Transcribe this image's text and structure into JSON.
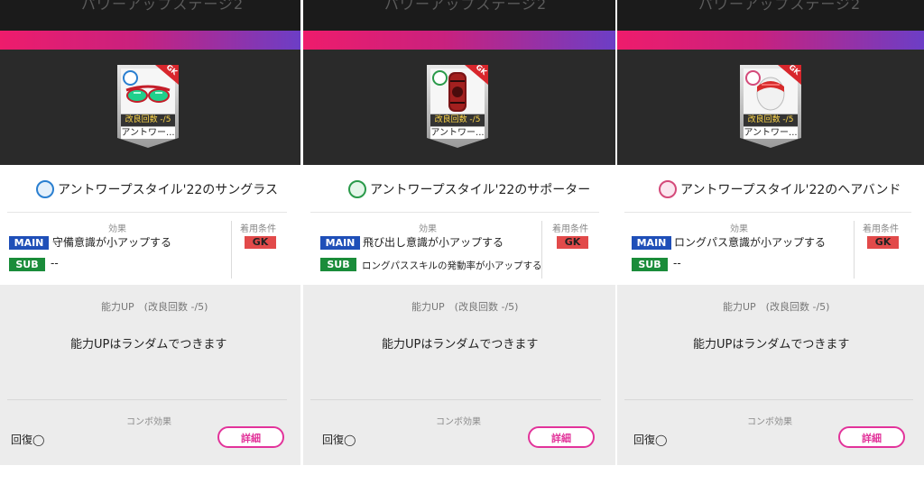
{
  "panels": [
    {
      "header_text": "パワーアップステージ2",
      "card": {
        "position": "GK",
        "kaizen": "改良回数 -/5",
        "name": "アントワー..."
      },
      "item_title": "アントワープスタイル'22のサングラス",
      "icon": "shirt-icon",
      "effect_label": "効果",
      "condition_label": "着用条件",
      "main_badge": "MAIN",
      "main_text": "守備意識が小アップする",
      "sub_badge": "SUB",
      "sub_text": "--",
      "condition_value": "GK",
      "up_label": "能力UP　(改良回数 -/5)",
      "up_text": "能力UPはランダムでつきます",
      "combo_label": "コンボ効果",
      "combo_value": "回復◯",
      "detail_label": "詳細"
    },
    {
      "header_text": "パワーアップステージ2",
      "card": {
        "position": "GK",
        "kaizen": "改良回数 -/5",
        "name": "アントワー..."
      },
      "item_title": "アントワープスタイル'22のサポーター",
      "icon": "leg-gear-icon",
      "effect_label": "効果",
      "condition_label": "着用条件",
      "main_badge": "MAIN",
      "main_text": "飛び出し意識が小アップする",
      "sub_badge": "SUB",
      "sub_text": "ロングパススキルの発動率が小アップする",
      "condition_value": "GK",
      "up_label": "能力UP　(改良回数 -/5)",
      "up_text": "能力UPはランダムでつきます",
      "combo_label": "コンボ効果",
      "combo_value": "回復◯",
      "detail_label": "詳細"
    },
    {
      "header_text": "パワーアップステージ2",
      "card": {
        "position": "GK",
        "kaizen": "改良回数 -/5",
        "name": "アントワー..."
      },
      "item_title": "アントワープスタイル'22のヘアバンド",
      "icon": "head-gear-icon",
      "effect_label": "効果",
      "condition_label": "着用条件",
      "main_badge": "MAIN",
      "main_text": "ロングパス意識が小アップする",
      "sub_badge": "SUB",
      "sub_text": "--",
      "condition_value": "GK",
      "up_label": "能力UP　(改良回数 -/5)",
      "up_text": "能力UPはランダムでつきます",
      "combo_label": "コンボ効果",
      "combo_value": "回復◯",
      "detail_label": "詳細"
    }
  ],
  "colors": {
    "stripe_start": "#ee1c6c",
    "stripe_end": "#6c3ec6",
    "main_badge": "#1f4fb8",
    "sub_badge": "#1a8c3a",
    "gk_tag": "#e24a4a",
    "detail_button": "#e2339a",
    "icon_colors": [
      "#2a7fd0",
      "#2a9a4a",
      "#d44a7a"
    ]
  }
}
